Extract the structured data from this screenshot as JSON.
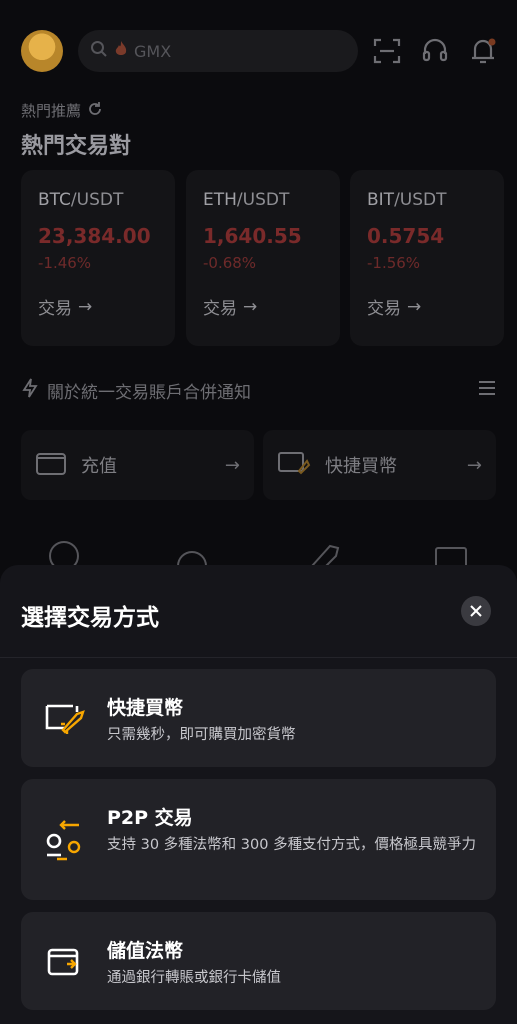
{
  "header": {
    "search_placeholder": "GMX",
    "icons": [
      "avatar",
      "search-icon",
      "fire-icon",
      "scan-icon",
      "headset-icon",
      "bell-icon"
    ]
  },
  "hot": {
    "label": "熱門推薦",
    "title": "熱門交易對",
    "cards": [
      {
        "base": "BTC",
        "quote": "/USDT",
        "price": "23,384.00",
        "change": "-1.46%",
        "trade": "交易"
      },
      {
        "base": "ETH",
        "quote": "/USDT",
        "price": "1,640.55",
        "change": "-0.68%",
        "trade": "交易"
      },
      {
        "base": "BIT",
        "quote": "/USDT",
        "price": "0.5754",
        "change": "-1.56%",
        "trade": "交易"
      }
    ]
  },
  "notice": {
    "text": "關於統一交易賬戶合併通知"
  },
  "actions": [
    {
      "label": "充值"
    },
    {
      "label": "快捷買幣"
    }
  ],
  "sheet": {
    "title": "選擇交易方式",
    "options": [
      {
        "title": "快捷買幣",
        "desc": "只需幾秒，即可購買加密貨幣",
        "icon": "rocket-card-icon"
      },
      {
        "title": "P2P 交易",
        "desc": "支持 30 多種法幣和 300 多種支付方式，價格極具競爭力",
        "icon": "p2p-exchange-icon"
      },
      {
        "title": "儲值法幣",
        "desc": "通過銀行轉賬或銀行卡儲值",
        "icon": "wallet-deposit-icon"
      }
    ]
  },
  "colors": {
    "accent": "#f7a600",
    "negative": "#7a2a2a",
    "sheet_bg": "#15151a",
    "option_bg": "#222227"
  }
}
